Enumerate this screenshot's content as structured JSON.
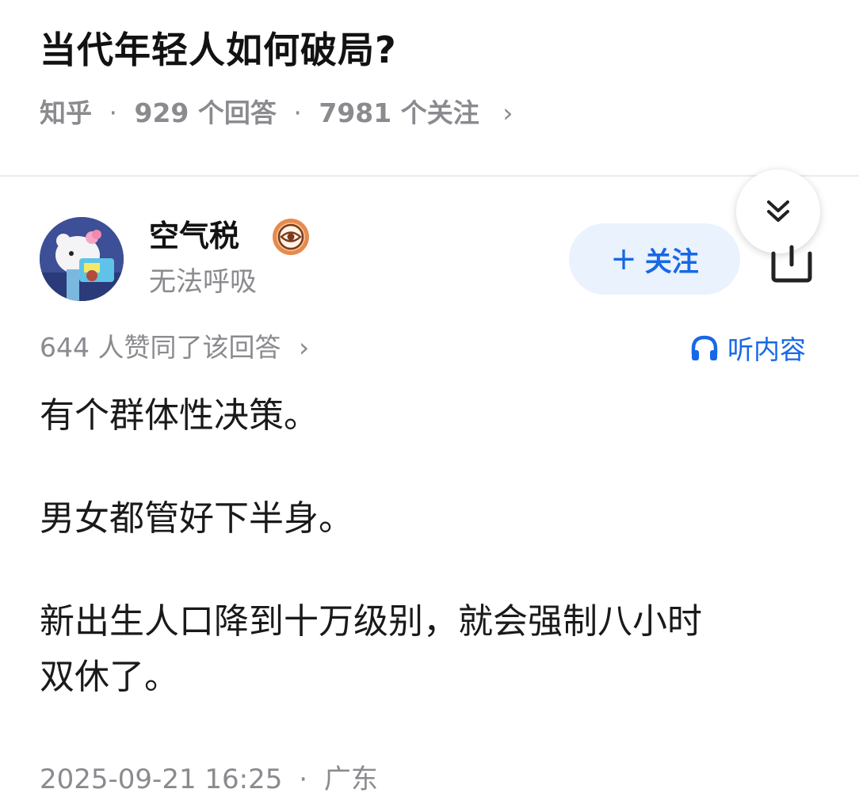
{
  "question": {
    "title": "当代年轻人如何破局?",
    "source": "知乎",
    "answers": "929 个回答",
    "followers": "7981 个关注",
    "separator": "·",
    "chevron": "›"
  },
  "author": {
    "name": "空气税",
    "bio": "无法呼吸",
    "follow_label": "关注",
    "follow_plus": "+"
  },
  "answer": {
    "votes": "644 人赞同了该回答",
    "listen_label": "听内容",
    "paragraphs": [
      "有个群体性决策。",
      "男女都管好下半身。",
      "新出生人口降到十万级别，就会强制八小时",
      "双休了。"
    ],
    "timestamp": "2025-09-21 16:25",
    "location": "广东"
  },
  "icons": {
    "collapse": "double-chevron-down-icon",
    "badge": "eye-badge-icon",
    "share": "share-icon",
    "listen": "headphones-icon"
  },
  "colors": {
    "accent": "#1768e6",
    "follow_bg": "#eaf2fd",
    "muted_text": "#8a8a8f"
  }
}
